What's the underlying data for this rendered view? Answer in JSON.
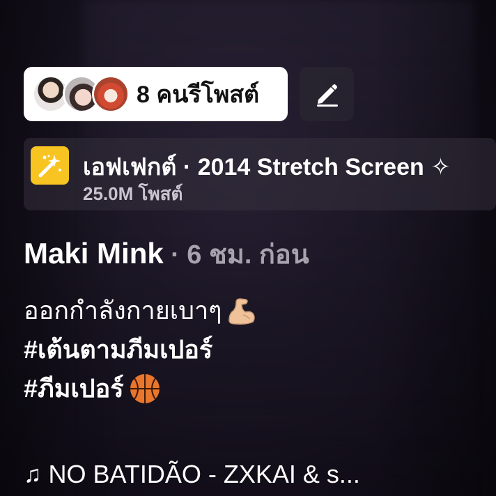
{
  "reposts": {
    "label": "8 คนรีโพสต์"
  },
  "effect": {
    "title": "เอฟเฟกต์ · 2014 Stretch Screen ✧",
    "posts": "25.0M โพสต์",
    "icon": "sparkle-wand-icon",
    "icon_color": "#f8c421"
  },
  "author": {
    "name": "Maki Mink",
    "separator": "·",
    "time": "6 ชม. ก่อน"
  },
  "caption": {
    "line1": "ออกกำลังกายเบาๆ",
    "line2": "#เต้นตามภีมเปอร์",
    "line3": "#ภีมเปอร์"
  },
  "music": {
    "note": "♫",
    "title": "NO BATIDÃO - ZXKAI & s..."
  },
  "icons": {
    "edit": "pencil-icon",
    "flex": "flexed-biceps-emoji",
    "ball": "basketball-emoji"
  }
}
